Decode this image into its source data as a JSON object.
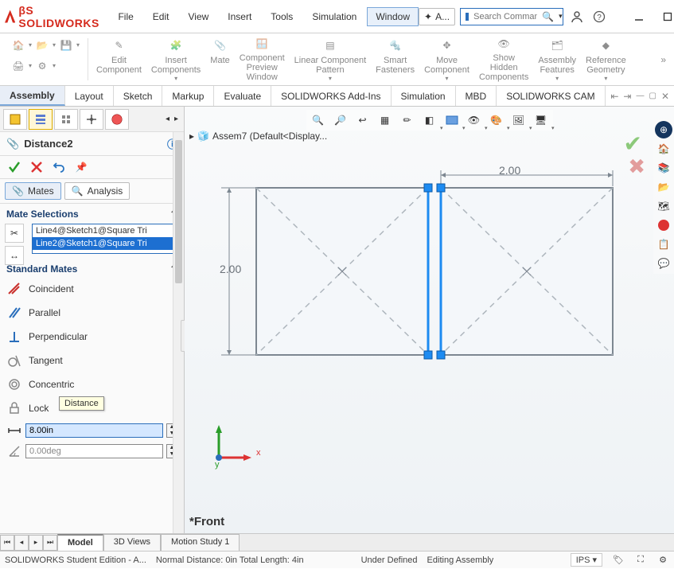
{
  "brand": "SOLIDWORKS",
  "menu": [
    "File",
    "Edit",
    "View",
    "Insert",
    "Tools",
    "Simulation",
    "Window"
  ],
  "menu_active": 6,
  "addin_chip": "A...",
  "search_placeholder": "Search Comman",
  "ribbon": {
    "groups": [
      {
        "label": "Edit\nComponent"
      },
      {
        "label": "Insert\nComponents"
      },
      {
        "label": "Mate"
      },
      {
        "label": "Component\nPreview\nWindow"
      },
      {
        "label": "Linear Component\nPattern"
      },
      {
        "label": "Smart\nFasteners"
      },
      {
        "label": "Move\nComponent"
      },
      {
        "label": "Show\nHidden\nComponents"
      },
      {
        "label": "Assembly\nFeatures"
      },
      {
        "label": "Reference\nGeometry"
      }
    ]
  },
  "cmd_tabs": [
    "Assembly",
    "Layout",
    "Sketch",
    "Markup",
    "Evaluate",
    "SOLIDWORKS Add-Ins",
    "Simulation",
    "MBD",
    "SOLIDWORKS CAM"
  ],
  "cmd_active": 0,
  "pm": {
    "title": "Distance2",
    "sub_tabs": {
      "mates": "Mates",
      "analysis": "Analysis"
    },
    "mate_selections_hdr": "Mate Selections",
    "selections": [
      "Line4@Sketch1@Square Tri",
      "Line2@Sketch1@Square Tri"
    ],
    "standard_mates_hdr": "Standard Mates",
    "mates": [
      "Coincident",
      "Parallel",
      "Perpendicular",
      "Tangent",
      "Concentric",
      "Lock"
    ],
    "distance_value": "8.00in",
    "angle_value": "0.00deg",
    "tooltip": "Distance"
  },
  "flyout": "Assem7  (Default<Display...",
  "dim_top": "2.00",
  "dim_left": "2.00",
  "axes": {
    "x": "x",
    "y": "y"
  },
  "view_name": "*Front",
  "btm_tabs": [
    "Model",
    "3D Views",
    "Motion Study 1"
  ],
  "btm_active": 0,
  "status": {
    "left": "SOLIDWORKS Student Edition - A...",
    "mid": "Normal Distance: 0in Total Length: 4in",
    "state": "Under Defined",
    "mode": "Editing Assembly",
    "units": "IPS"
  }
}
